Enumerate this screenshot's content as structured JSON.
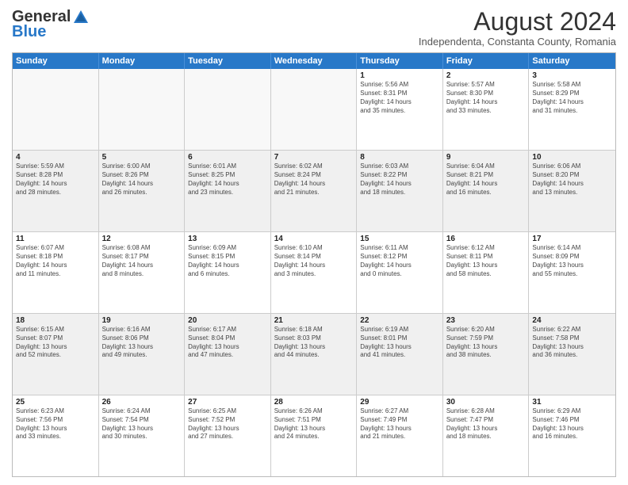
{
  "header": {
    "logo_general": "General",
    "logo_blue": "Blue",
    "month": "August 2024",
    "location": "Independenta, Constanta County, Romania"
  },
  "weekdays": [
    "Sunday",
    "Monday",
    "Tuesday",
    "Wednesday",
    "Thursday",
    "Friday",
    "Saturday"
  ],
  "rows": [
    [
      {
        "day": "",
        "info": ""
      },
      {
        "day": "",
        "info": ""
      },
      {
        "day": "",
        "info": ""
      },
      {
        "day": "",
        "info": ""
      },
      {
        "day": "1",
        "info": "Sunrise: 5:56 AM\nSunset: 8:31 PM\nDaylight: 14 hours\nand 35 minutes."
      },
      {
        "day": "2",
        "info": "Sunrise: 5:57 AM\nSunset: 8:30 PM\nDaylight: 14 hours\nand 33 minutes."
      },
      {
        "day": "3",
        "info": "Sunrise: 5:58 AM\nSunset: 8:29 PM\nDaylight: 14 hours\nand 31 minutes."
      }
    ],
    [
      {
        "day": "4",
        "info": "Sunrise: 5:59 AM\nSunset: 8:28 PM\nDaylight: 14 hours\nand 28 minutes."
      },
      {
        "day": "5",
        "info": "Sunrise: 6:00 AM\nSunset: 8:26 PM\nDaylight: 14 hours\nand 26 minutes."
      },
      {
        "day": "6",
        "info": "Sunrise: 6:01 AM\nSunset: 8:25 PM\nDaylight: 14 hours\nand 23 minutes."
      },
      {
        "day": "7",
        "info": "Sunrise: 6:02 AM\nSunset: 8:24 PM\nDaylight: 14 hours\nand 21 minutes."
      },
      {
        "day": "8",
        "info": "Sunrise: 6:03 AM\nSunset: 8:22 PM\nDaylight: 14 hours\nand 18 minutes."
      },
      {
        "day": "9",
        "info": "Sunrise: 6:04 AM\nSunset: 8:21 PM\nDaylight: 14 hours\nand 16 minutes."
      },
      {
        "day": "10",
        "info": "Sunrise: 6:06 AM\nSunset: 8:20 PM\nDaylight: 14 hours\nand 13 minutes."
      }
    ],
    [
      {
        "day": "11",
        "info": "Sunrise: 6:07 AM\nSunset: 8:18 PM\nDaylight: 14 hours\nand 11 minutes."
      },
      {
        "day": "12",
        "info": "Sunrise: 6:08 AM\nSunset: 8:17 PM\nDaylight: 14 hours\nand 8 minutes."
      },
      {
        "day": "13",
        "info": "Sunrise: 6:09 AM\nSunset: 8:15 PM\nDaylight: 14 hours\nand 6 minutes."
      },
      {
        "day": "14",
        "info": "Sunrise: 6:10 AM\nSunset: 8:14 PM\nDaylight: 14 hours\nand 3 minutes."
      },
      {
        "day": "15",
        "info": "Sunrise: 6:11 AM\nSunset: 8:12 PM\nDaylight: 14 hours\nand 0 minutes."
      },
      {
        "day": "16",
        "info": "Sunrise: 6:12 AM\nSunset: 8:11 PM\nDaylight: 13 hours\nand 58 minutes."
      },
      {
        "day": "17",
        "info": "Sunrise: 6:14 AM\nSunset: 8:09 PM\nDaylight: 13 hours\nand 55 minutes."
      }
    ],
    [
      {
        "day": "18",
        "info": "Sunrise: 6:15 AM\nSunset: 8:07 PM\nDaylight: 13 hours\nand 52 minutes."
      },
      {
        "day": "19",
        "info": "Sunrise: 6:16 AM\nSunset: 8:06 PM\nDaylight: 13 hours\nand 49 minutes."
      },
      {
        "day": "20",
        "info": "Sunrise: 6:17 AM\nSunset: 8:04 PM\nDaylight: 13 hours\nand 47 minutes."
      },
      {
        "day": "21",
        "info": "Sunrise: 6:18 AM\nSunset: 8:03 PM\nDaylight: 13 hours\nand 44 minutes."
      },
      {
        "day": "22",
        "info": "Sunrise: 6:19 AM\nSunset: 8:01 PM\nDaylight: 13 hours\nand 41 minutes."
      },
      {
        "day": "23",
        "info": "Sunrise: 6:20 AM\nSunset: 7:59 PM\nDaylight: 13 hours\nand 38 minutes."
      },
      {
        "day": "24",
        "info": "Sunrise: 6:22 AM\nSunset: 7:58 PM\nDaylight: 13 hours\nand 36 minutes."
      }
    ],
    [
      {
        "day": "25",
        "info": "Sunrise: 6:23 AM\nSunset: 7:56 PM\nDaylight: 13 hours\nand 33 minutes."
      },
      {
        "day": "26",
        "info": "Sunrise: 6:24 AM\nSunset: 7:54 PM\nDaylight: 13 hours\nand 30 minutes."
      },
      {
        "day": "27",
        "info": "Sunrise: 6:25 AM\nSunset: 7:52 PM\nDaylight: 13 hours\nand 27 minutes."
      },
      {
        "day": "28",
        "info": "Sunrise: 6:26 AM\nSunset: 7:51 PM\nDaylight: 13 hours\nand 24 minutes."
      },
      {
        "day": "29",
        "info": "Sunrise: 6:27 AM\nSunset: 7:49 PM\nDaylight: 13 hours\nand 21 minutes."
      },
      {
        "day": "30",
        "info": "Sunrise: 6:28 AM\nSunset: 7:47 PM\nDaylight: 13 hours\nand 18 minutes."
      },
      {
        "day": "31",
        "info": "Sunrise: 6:29 AM\nSunset: 7:46 PM\nDaylight: 13 hours\nand 16 minutes."
      }
    ]
  ]
}
